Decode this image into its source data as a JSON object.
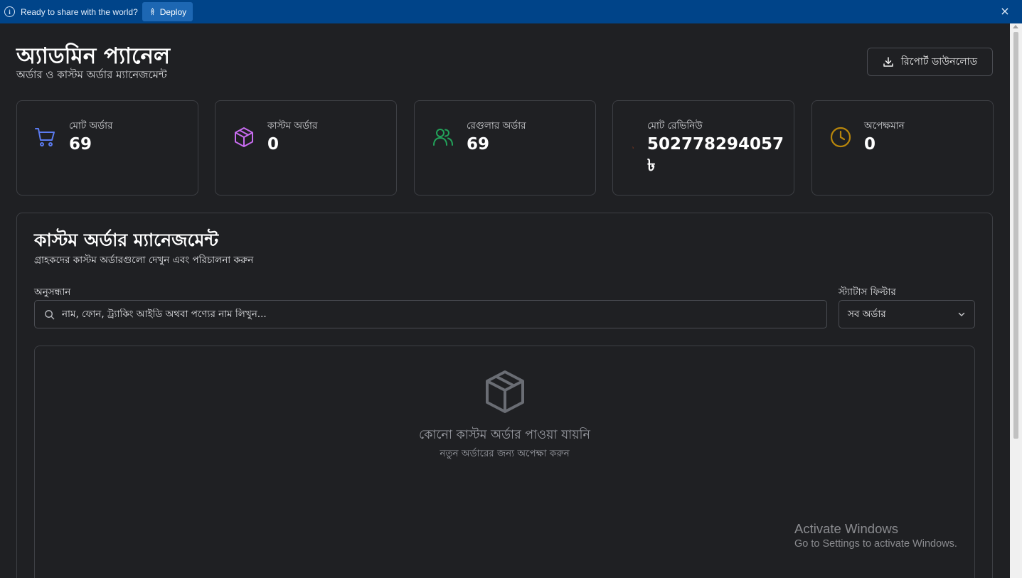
{
  "topbar": {
    "message": "Ready to share with the world?",
    "deploy_label": "Deploy",
    "close_glyph": "×"
  },
  "header": {
    "title": "অ্যাডমিন প্যানেল",
    "subtitle": "অর্ডার ও কাস্টম অর্ডার ম্যানেজমেন্ট",
    "report_button_label": "রিপোর্ট ডাউনলোড"
  },
  "stats": [
    {
      "label": "মোট অর্ডার",
      "value": "69",
      "icon": "cart-icon",
      "color": "#5b7bf0"
    },
    {
      "label": "কাস্টম অর্ডার",
      "value": "0",
      "icon": "package-icon",
      "color": "#c86cf0"
    },
    {
      "label": "রেগুলার অর্ডার",
      "value": "69",
      "icon": "users-icon",
      "color": "#22a35a"
    },
    {
      "label": "মোট রেভিনিউ",
      "value": "502778294057 ৳",
      "icon": "taka-icon",
      "color": "#c0451c"
    },
    {
      "label": "অপেক্ষমান",
      "value": "0",
      "icon": "clock-icon",
      "color": "#b8860b"
    }
  ],
  "panel": {
    "title": "কাস্টম অর্ডার ম্যানেজমেন্ট",
    "subtitle": "গ্রাহকদের কাস্টম অর্ডারগুলো দেখুন এবং পরিচালনা করুন",
    "search_label": "অনুসন্ধান",
    "search_placeholder": "নাম, ফোন, ট্র্যাকিং আইডি অথবা পণ্যের নাম লিখুন...",
    "filter_label": "স্ট্যাটাস ফিল্টার",
    "filter_value": "সব অর্ডার",
    "empty_title": "কোনো কাস্টম অর্ডার পাওয়া যায়নি",
    "empty_subtitle": "নতুন অর্ডারের জন্য অপেক্ষা করুন"
  },
  "watermark": {
    "line1": "Activate Windows",
    "line2": "Go to Settings to activate Windows."
  }
}
